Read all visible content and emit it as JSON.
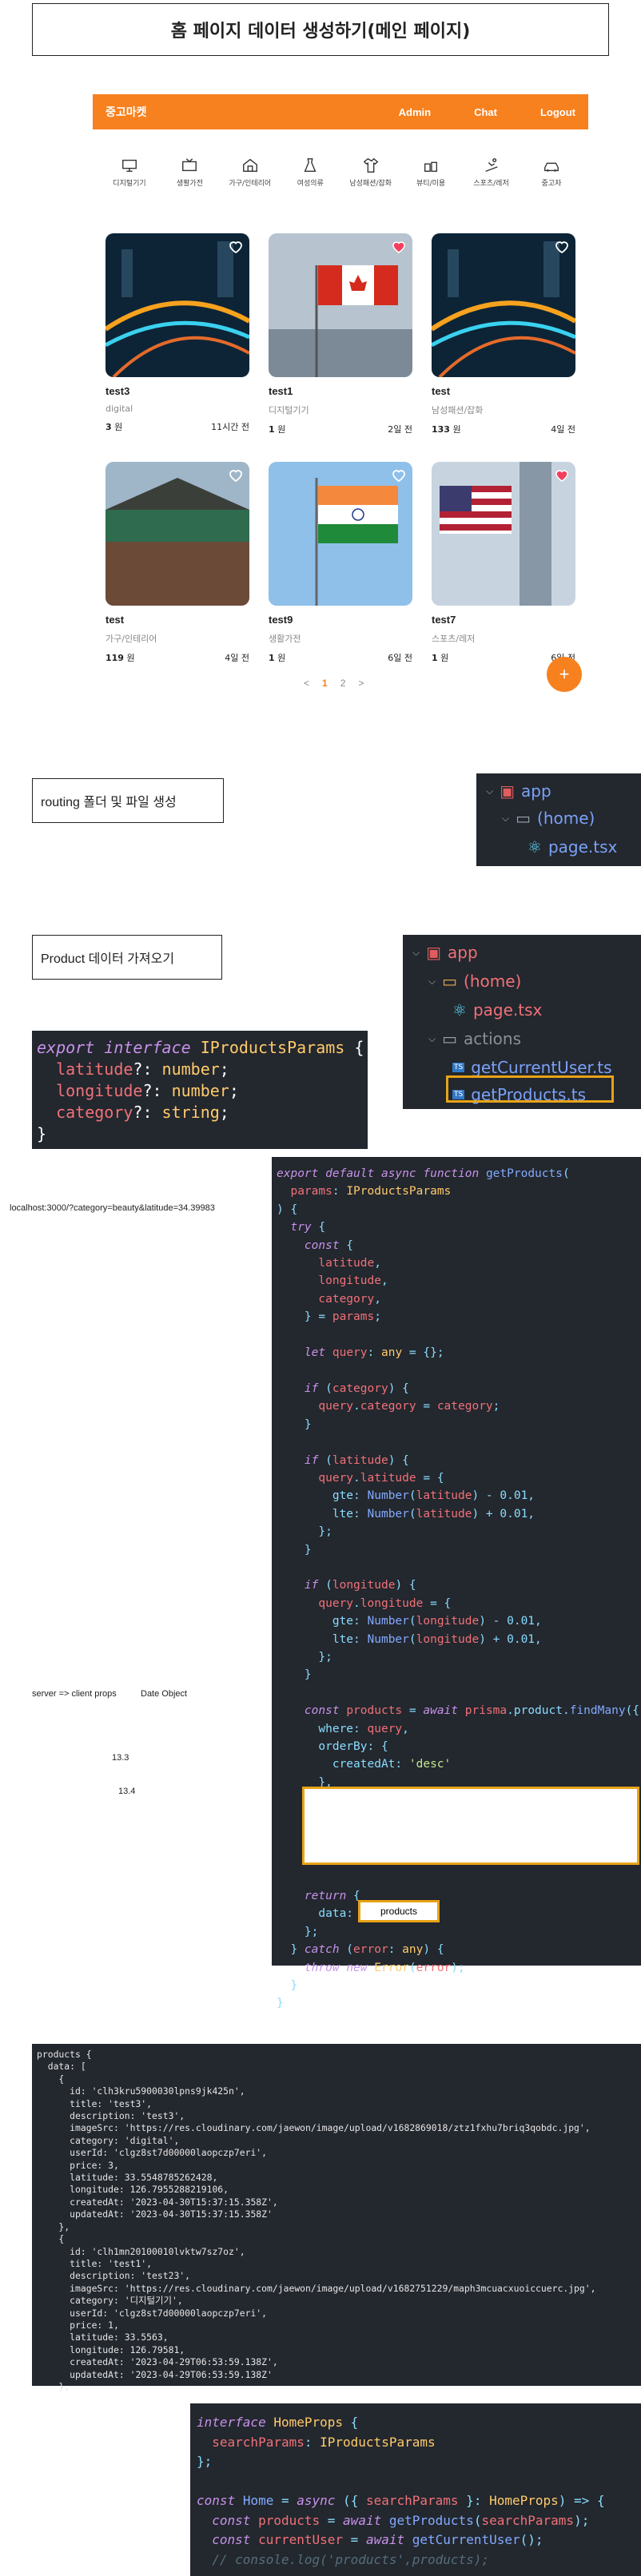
{
  "title": "홈 페이지 데이터 생성하기(메인 페이지)",
  "header": {
    "logo": "중고마켓",
    "nav": [
      "Admin",
      "Chat",
      "Logout"
    ],
    "color": "#f7811e"
  },
  "categories": [
    "디지털기기",
    "생활가전",
    "가구/인테리어",
    "여성의류",
    "남성패션/잡화",
    "뷰티/미용",
    "스포츠/레저",
    "중고차"
  ],
  "products": [
    {
      "title": "test3",
      "category": "digital",
      "price": "3",
      "unit": "원",
      "time": "11시간 전",
      "liked": false,
      "image": "city-night"
    },
    {
      "title": "test1",
      "category": "디지털기기",
      "price": "1",
      "unit": "원",
      "time": "2일 전",
      "liked": true,
      "image": "canada-flag"
    },
    {
      "title": "test",
      "category": "남성패션/잡화",
      "price": "133",
      "unit": "원",
      "time": "4일 전",
      "liked": false,
      "image": "city-night"
    },
    {
      "title": "test",
      "category": "가구/인테리어",
      "price": "119",
      "unit": "원",
      "time": "4일 전",
      "liked": false,
      "image": "palace"
    },
    {
      "title": "test9",
      "category": "생활가전",
      "price": "1",
      "unit": "원",
      "time": "6일 전",
      "liked": false,
      "image": "india-flag"
    },
    {
      "title": "test7",
      "category": "스포츠/레저",
      "price": "1",
      "unit": "원",
      "time": "6일 전",
      "liked": true,
      "image": "us-flag"
    }
  ],
  "pagination": {
    "prev": "<",
    "pages": [
      "1",
      "2"
    ],
    "current": "1",
    "next": ">"
  },
  "fab": "+",
  "section_routing": "routing 폴더 및 파일 생성",
  "tree1": {
    "root": "app",
    "folder": "(home)",
    "file": "page.tsx"
  },
  "section_product": "Product 데이터 가져오기",
  "tree2": {
    "root": "app",
    "folder": "(home)",
    "file1": "page.tsx",
    "folder2": "actions",
    "file2": "getCurrentUser.ts",
    "file3": "getProducts.ts"
  },
  "interface_code": [
    "export interface IProductsParams {",
    "  latitude?: number;",
    "  longitude?: number;",
    "  category?: string;",
    "}"
  ],
  "url_note": "localhost:3000/?category=beauty&latitude=34.39983",
  "server_note": "server => client props",
  "date_note": "Date Object",
  "version_a": "13.3",
  "version_b": "13.4",
  "get_products_code": [
    "export default async function getProducts(",
    "  params: IProductsParams",
    ") {",
    "  try {",
    "    const {",
    "      latitude,",
    "      longitude,",
    "      category,",
    "    } = params;",
    "",
    "    let query: any = {};",
    "",
    "    if (category) {",
    "      query.category = category;",
    "    }",
    "",
    "    if (latitude) {",
    "      query.latitude = {",
    "        gte: Number(latitude) - 0.01,",
    "        lte: Number(latitude) + 0.01,",
    "      };",
    "    }",
    "",
    "    if (longitude) {",
    "      query.longitude = {",
    "        gte: Number(longitude) - 0.01,",
    "        lte: Number(longitude) + 0.01,",
    "      };",
    "    }",
    "",
    "    const products = await prisma.product.findMany({",
    "      where: query,",
    "      orderBy: {",
    "        createdAt: 'desc'",
    "      },",
    "    });"
  ],
  "return_code": [
    "    return {",
    "      data:",
    "    };",
    "  } catch (error: any) {",
    "    throw new Error(error);",
    "  }",
    "}"
  ],
  "products_label": "products",
  "products_dump": [
    "products {",
    "  data: [",
    "    {",
    "      id: 'clh3kru5900030lpns9jk425n',",
    "      title: 'test3',",
    "      description: 'test3',",
    "      imageSrc: 'https://res.cloudinary.com/jaewon/image/upload/v1682869018/ztz1fxhu7briq3qobdc.jpg',",
    "      category: 'digital',",
    "      userId: 'clgz8st7d00000laopczp7eri',",
    "      price: 3,",
    "      latitude: 33.5548785262428,",
    "      longitude: 126.7955288219106,",
    "      createdAt: '2023-04-30T15:37:15.358Z',",
    "      updatedAt: '2023-04-30T15:37:15.358Z'",
    "    },",
    "    {",
    "      id: 'clh1mn20100010lvktw7sz7oz',",
    "      title: 'test1',",
    "      description: 'test23',",
    "      imageSrc: 'https://res.cloudinary.com/jaewon/image/upload/v1682751229/maph3mcuacxuoiccuerc.jpg',",
    "      category: '디지털기기',",
    "      userId: 'clgz8st7d00000laopczp7eri',",
    "      price: 1,",
    "      latitude: 33.5563,",
    "      longitude: 126.79581,",
    "      createdAt: '2023-04-29T06:53:59.138Z',",
    "      updatedAt: '2023-04-29T06:53:59.138Z'",
    "    },"
  ],
  "home_code": [
    "interface HomeProps {",
    "  searchParams: IProductsParams",
    "};",
    "",
    "const Home = async ({ searchParams }: HomeProps) => {",
    "  const products = await getProducts(searchParams);",
    "  const currentUser = await getCurrentUser();",
    "  // console.log('products',products);"
  ]
}
